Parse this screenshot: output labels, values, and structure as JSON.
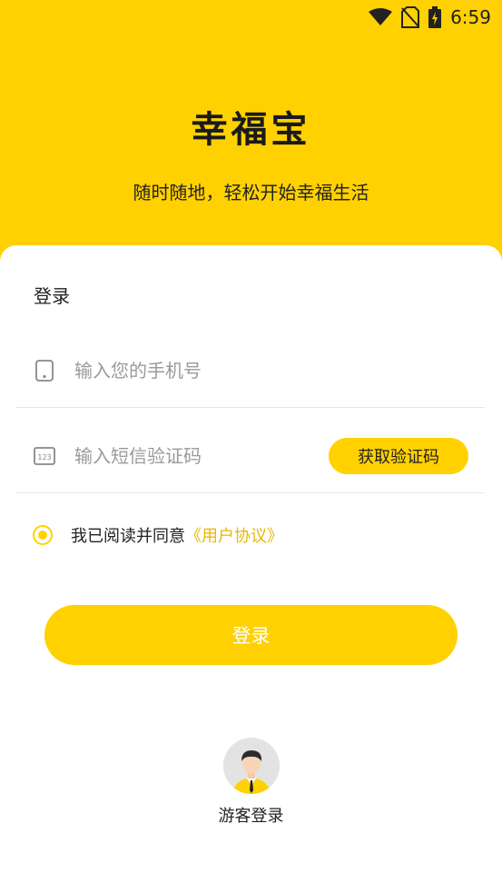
{
  "status_bar": {
    "time": "6:59",
    "icons": [
      "wifi-icon",
      "no-sim-icon",
      "battery-charging-icon"
    ]
  },
  "header": {
    "title": "幸福宝",
    "subtitle": "随时随地，轻松开始幸福生活"
  },
  "login_form": {
    "section_title": "登录",
    "phone_placeholder": "输入您的手机号",
    "phone_value": "",
    "code_placeholder": "输入短信验证码",
    "code_value": "",
    "get_code_label": "获取验证码",
    "agreement_text": "我已阅读并同意",
    "agreement_link": "《用户协议》",
    "agreement_checked": true,
    "login_button_label": "登录"
  },
  "guest": {
    "label": "游客登录"
  },
  "colors": {
    "accent": "#FFD100",
    "link": "#E8B800",
    "text": "#222222",
    "placeholder": "#9A9A9A"
  }
}
